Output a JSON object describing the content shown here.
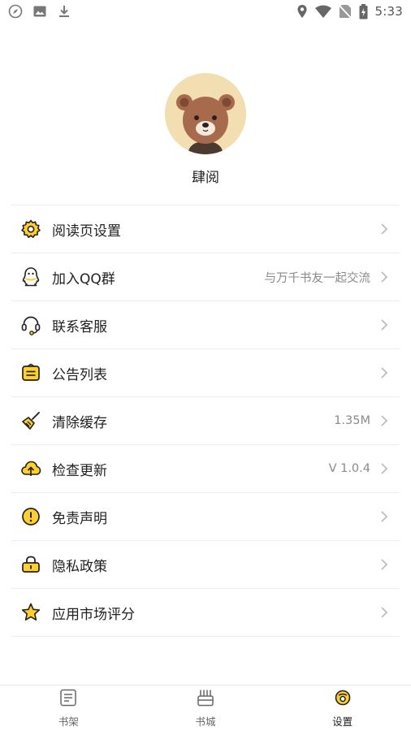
{
  "status_bar": {
    "time": "5:33"
  },
  "profile": {
    "username": "肆阅"
  },
  "menu": [
    {
      "label": "阅读页设置",
      "value": "",
      "icon": "gear-icon"
    },
    {
      "label": "加入QQ群",
      "value": "与万千书友一起交流",
      "icon": "qq-penguin-icon"
    },
    {
      "label": "联系客服",
      "value": "",
      "icon": "headset-icon"
    },
    {
      "label": "公告列表",
      "value": "",
      "icon": "notice-icon"
    },
    {
      "label": "清除缓存",
      "value": "1.35M",
      "icon": "broom-icon"
    },
    {
      "label": "检查更新",
      "value": "V 1.0.4",
      "icon": "cloud-upload-icon"
    },
    {
      "label": "免责声明",
      "value": "",
      "icon": "alert-circle-icon"
    },
    {
      "label": "隐私政策",
      "value": "",
      "icon": "lock-icon"
    },
    {
      "label": "应用市场评分",
      "value": "",
      "icon": "star-icon"
    }
  ],
  "bottom_nav": [
    {
      "label": "书架",
      "icon": "bookshelf-icon"
    },
    {
      "label": "书城",
      "icon": "bookstore-icon"
    },
    {
      "label": "设置",
      "icon": "settings-icon",
      "active": true
    }
  ],
  "colors": {
    "accent": "#ffcf2e",
    "divider": "#ececec",
    "text": "#222222",
    "secondary": "#8a8a8a"
  }
}
